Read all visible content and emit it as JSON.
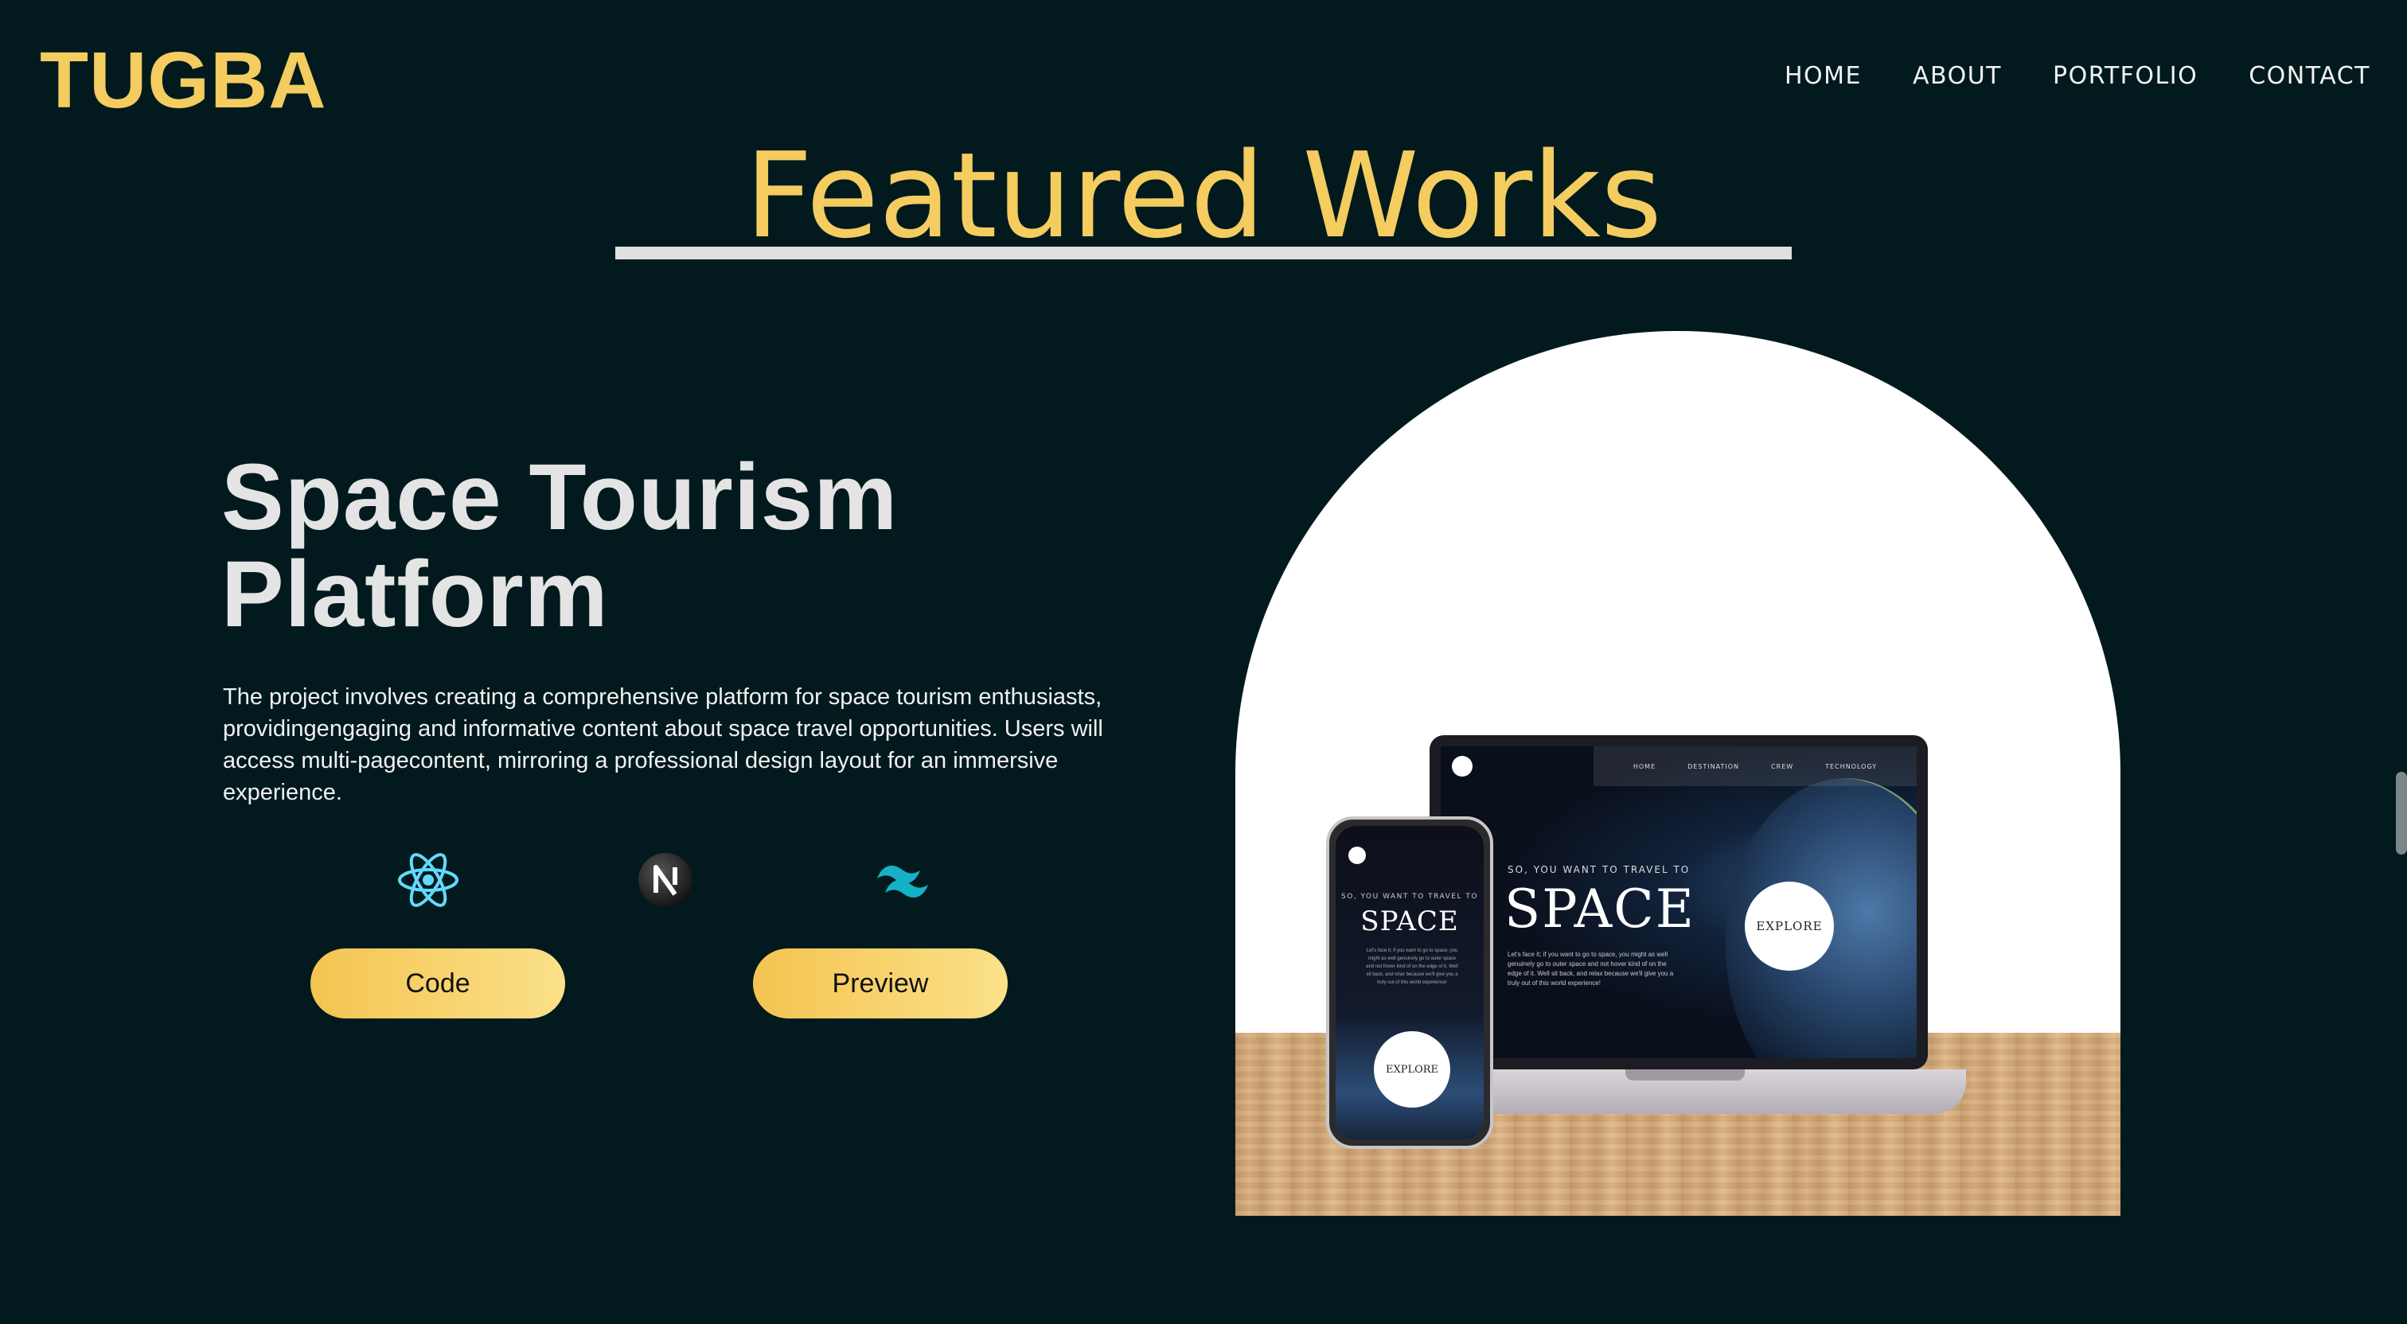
{
  "brand": {
    "logo": "TUGBA"
  },
  "nav": {
    "items": [
      {
        "label": "HOME"
      },
      {
        "label": "ABOUT"
      },
      {
        "label": "PORTFOLIO"
      },
      {
        "label": "CONTACT"
      }
    ]
  },
  "section": {
    "title": "Featured Works"
  },
  "project": {
    "title_line1": "Space Tourism",
    "title_line2": "Platform",
    "description": "The project involves creating a comprehensive platform for space tourism enthusiasts, providingengaging and informative content about space travel opportunities. Users will access multi-pagecontent, mirroring a professional design layout for an immersive experience.",
    "tech_icons": [
      "react-icon",
      "nextjs-icon",
      "tailwind-icon"
    ],
    "buttons": {
      "code": "Code",
      "preview": "Preview"
    }
  },
  "mockup": {
    "laptop": {
      "nav": [
        "HOME",
        "DESTINATION",
        "CREW",
        "TECHNOLOGY"
      ],
      "subtitle": "SO, YOU WANT TO TRAVEL TO",
      "headline": "SPACE",
      "body": "Let's face it; if you want to go to space, you might as well genuinely go to outer space and not hover kind of on the edge of it. Well sit back, and relax because we'll give you a truly out of this world experience!",
      "explore": "EXPLORE"
    },
    "phone": {
      "subtitle": "SO, YOU WANT TO TRAVEL TO",
      "headline": "SPACE",
      "explore": "EXPLORE"
    }
  },
  "colors": {
    "background": "#021a1d",
    "accent": "#f4cc60",
    "text": "#e6e6e6"
  }
}
